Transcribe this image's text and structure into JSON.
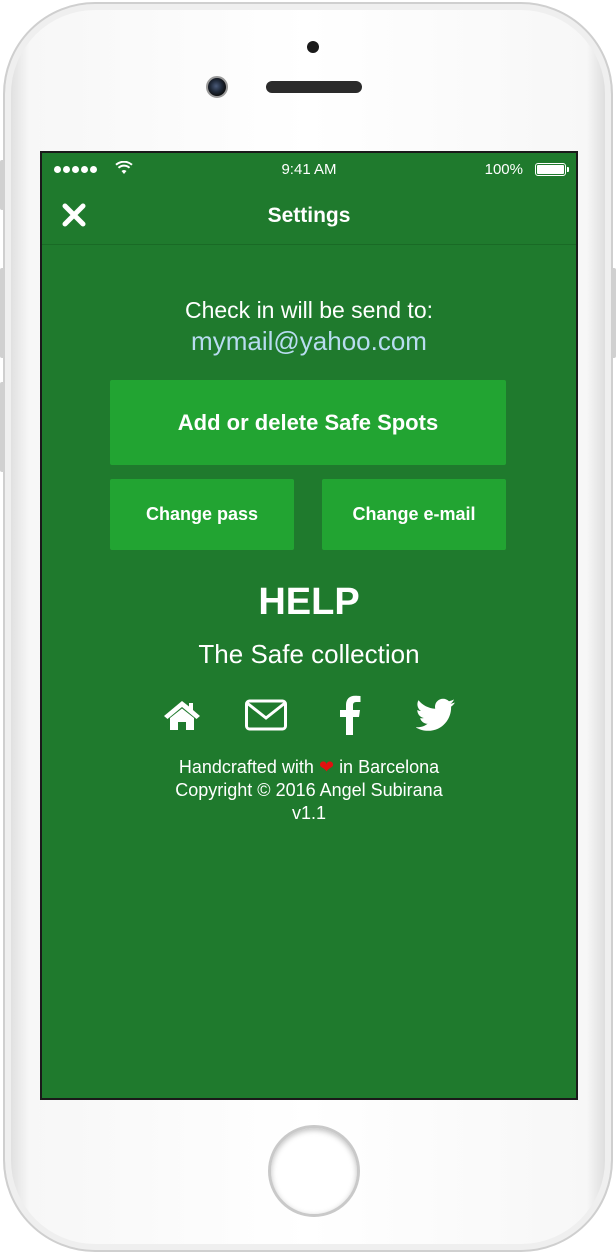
{
  "status_bar": {
    "time": "9:41 AM",
    "battery": "100%"
  },
  "nav": {
    "title": "Settings",
    "close_icon": "close-icon"
  },
  "checkin": {
    "label": "Check in will be send to:",
    "email": "mymail@yahoo.com"
  },
  "buttons": {
    "safe_spots": "Add or delete Safe Spots",
    "change_pass": "Change pass",
    "change_email": "Change e-mail"
  },
  "help": {
    "title": "HELP",
    "collection": "The Safe collection"
  },
  "social_icons": [
    "home-icon",
    "mail-icon",
    "facebook-icon",
    "twitter-icon"
  ],
  "footer": {
    "handcrafted_pre": "Handcrafted with",
    "handcrafted_post": "in Barcelona",
    "copyright": "Copyright © 2016 Angel Subirana",
    "version": "v1.1"
  },
  "colors": {
    "background": "#1f7a2d",
    "button": "#22a432",
    "email_text": "#b8dcf0",
    "heart": "#e01010"
  }
}
